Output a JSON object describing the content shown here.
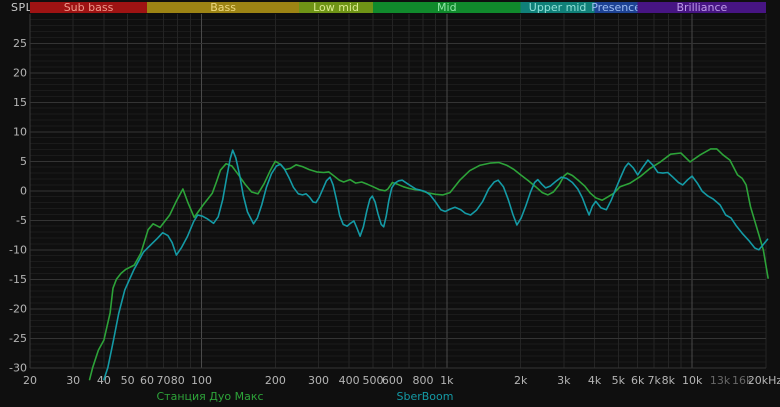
{
  "chart_data": {
    "type": "line",
    "title": "",
    "ylabel": "SPL",
    "xlabel": "",
    "x_scale": "log",
    "xlim": [
      20,
      20000
    ],
    "ylim": [
      -30,
      30
    ],
    "y_tick_step": 5,
    "grid": true,
    "legend_position": "bottom",
    "colors": {
      "background": "#0f0f0f",
      "grid_minor_h": "#1b1b1b",
      "grid_major_h": "#343434",
      "grid_v": "#242424",
      "grid_v_decade": "#4a4a4a",
      "tick_text": "#b5b5b5",
      "tick_text_dim": "#686868",
      "axis_title": "#c9c9c9"
    },
    "bands": [
      {
        "label": "Sub bass",
        "f1": 20,
        "f2": 60,
        "bg": "#9e1313",
        "fg": "#ef9a8c"
      },
      {
        "label": "Bass",
        "f1": 60,
        "f2": 250,
        "bg": "#9d8414",
        "fg": "#ecd87f"
      },
      {
        "label": "Low mid",
        "f1": 250,
        "f2": 500,
        "bg": "#6f9416",
        "fg": "#d9ea8f"
      },
      {
        "label": "Mid",
        "f1": 500,
        "f2": 2000,
        "bg": "#108a2c",
        "fg": "#8fe7a6"
      },
      {
        "label": "Upper mid",
        "f1": 2000,
        "f2": 4000,
        "bg": "#108078",
        "fg": "#8fe0d8"
      },
      {
        "label": "Presence",
        "f1": 4000,
        "f2": 6000,
        "bg": "#1e4394",
        "fg": "#9dbdf2"
      },
      {
        "label": "Brilliance",
        "f1": 6000,
        "f2": 20000,
        "bg": "#471583",
        "fg": "#bd9ae8"
      }
    ],
    "y_ticks": [
      25,
      20,
      15,
      10,
      5,
      0,
      -5,
      -10,
      -15,
      -20,
      -25,
      -30
    ],
    "x_ticks": [
      {
        "label": "20",
        "f": 20,
        "dim": false
      },
      {
        "label": "30",
        "f": 30,
        "dim": false
      },
      {
        "label": "40",
        "f": 40,
        "dim": false
      },
      {
        "label": "50",
        "f": 50,
        "dim": false
      },
      {
        "label": "60",
        "f": 60,
        "dim": false
      },
      {
        "label": "70",
        "f": 70,
        "dim": false
      },
      {
        "label": "80",
        "f": 80,
        "dim": false
      },
      {
        "label": "100",
        "f": 100,
        "dim": false
      },
      {
        "label": "200",
        "f": 200,
        "dim": false
      },
      {
        "label": "300",
        "f": 300,
        "dim": false
      },
      {
        "label": "400",
        "f": 400,
        "dim": false
      },
      {
        "label": "500",
        "f": 500,
        "dim": false
      },
      {
        "label": "600",
        "f": 600,
        "dim": false
      },
      {
        "label": "800",
        "f": 800,
        "dim": false
      },
      {
        "label": "1k",
        "f": 1000,
        "dim": false
      },
      {
        "label": "2k",
        "f": 2000,
        "dim": false
      },
      {
        "label": "3k",
        "f": 3000,
        "dim": false
      },
      {
        "label": "4k",
        "f": 4000,
        "dim": false
      },
      {
        "label": "5k",
        "f": 5000,
        "dim": false
      },
      {
        "label": "6k",
        "f": 6000,
        "dim": false
      },
      {
        "label": "7k",
        "f": 7000,
        "dim": false
      },
      {
        "label": "8k",
        "f": 8000,
        "dim": false
      },
      {
        "label": "10k",
        "f": 10000,
        "dim": false
      },
      {
        "label": "13k",
        "f": 13000,
        "dim": true
      },
      {
        "label": "16k",
        "f": 16000,
        "dim": true
      },
      {
        "label": "20kHz",
        "f": 19800,
        "dim": false
      }
    ],
    "series": [
      {
        "name": "Станция Дуо Макс",
        "color": "#2da339",
        "points": [
          [
            35,
            -32
          ],
          [
            36,
            -30
          ],
          [
            38,
            -27
          ],
          [
            40,
            -25.3
          ],
          [
            42.4,
            -20.7
          ],
          [
            43.6,
            -16.5
          ],
          [
            45,
            -15
          ],
          [
            47,
            -14
          ],
          [
            49.2,
            -13.3
          ],
          [
            53.2,
            -12.6
          ],
          [
            56.6,
            -10.6
          ],
          [
            60.6,
            -6.6
          ],
          [
            63.5,
            -5.6
          ],
          [
            67.8,
            -6.2
          ],
          [
            74.2,
            -4.1
          ],
          [
            79.3,
            -1.6
          ],
          [
            84,
            0.3
          ],
          [
            88,
            -2
          ],
          [
            93.4,
            -4.5
          ],
          [
            101.5,
            -2.4
          ],
          [
            110.7,
            -0.4
          ],
          [
            115,
            1.5
          ],
          [
            119.4,
            3.5
          ],
          [
            126,
            4.6
          ],
          [
            133,
            4.2
          ],
          [
            141,
            2.8
          ],
          [
            150,
            1.2
          ],
          [
            160,
            -0.2
          ],
          [
            170,
            -0.5
          ],
          [
            180,
            1.2
          ],
          [
            190,
            3.3
          ],
          [
            200,
            5
          ],
          [
            210,
            4.5
          ],
          [
            219,
            3.6
          ],
          [
            230,
            3.8
          ],
          [
            243,
            4.4
          ],
          [
            258,
            4.1
          ],
          [
            275,
            3.6
          ],
          [
            295,
            3.2
          ],
          [
            315,
            3.1
          ],
          [
            330,
            3.2
          ],
          [
            345,
            2.6
          ],
          [
            365,
            1.8
          ],
          [
            380,
            1.5
          ],
          [
            403,
            1.9
          ],
          [
            425,
            1.3
          ],
          [
            450,
            1.5
          ],
          [
            475,
            1.1
          ],
          [
            500,
            0.7
          ],
          [
            530,
            0.2
          ],
          [
            560,
            0
          ],
          [
            575,
            0.3
          ],
          [
            600,
            1.4
          ],
          [
            630,
            1.1
          ],
          [
            665,
            0.7
          ],
          [
            700,
            0.4
          ],
          [
            740,
            0.2
          ],
          [
            780,
            0.1
          ],
          [
            830,
            -0.3
          ],
          [
            900,
            -0.6
          ],
          [
            965,
            -0.7
          ],
          [
            1030,
            -0.3
          ],
          [
            1130,
            1.8
          ],
          [
            1240,
            3.4
          ],
          [
            1360,
            4.3
          ],
          [
            1500,
            4.7
          ],
          [
            1630,
            4.8
          ],
          [
            1760,
            4.3
          ],
          [
            1880,
            3.6
          ],
          [
            2000,
            2.7
          ],
          [
            2150,
            1.7
          ],
          [
            2300,
            0.7
          ],
          [
            2450,
            -0.3
          ],
          [
            2580,
            -0.7
          ],
          [
            2720,
            -0.2
          ],
          [
            2870,
            1
          ],
          [
            3000,
            2.5
          ],
          [
            3100,
            3
          ],
          [
            3250,
            2.6
          ],
          [
            3450,
            1.7
          ],
          [
            3650,
            0.8
          ],
          [
            3850,
            -0.4
          ],
          [
            4050,
            -1.2
          ],
          [
            4300,
            -1.6
          ],
          [
            4550,
            -1
          ],
          [
            4800,
            -0.4
          ],
          [
            5085,
            0.7
          ],
          [
            5590,
            1.3
          ],
          [
            6140,
            2.4
          ],
          [
            6740,
            3.8
          ],
          [
            7420,
            4.9
          ],
          [
            8170,
            6.2
          ],
          [
            9000,
            6.4
          ],
          [
            9810,
            4.9
          ],
          [
            10800,
            6.1
          ],
          [
            11900,
            7.1
          ],
          [
            12600,
            7.1
          ],
          [
            13350,
            6.1
          ],
          [
            14250,
            5.2
          ],
          [
            15300,
            2.7
          ],
          [
            16000,
            2.1
          ],
          [
            16600,
            1
          ],
          [
            17300,
            -2.7
          ],
          [
            18300,
            -6.1
          ],
          [
            19500,
            -10
          ],
          [
            20400,
            -14.8
          ]
        ]
      },
      {
        "name": "SberBoom",
        "color": "#149aa5",
        "points": [
          [
            40,
            -32
          ],
          [
            41.5,
            -30
          ],
          [
            43.8,
            -25.3
          ],
          [
            46,
            -20.8
          ],
          [
            48.7,
            -16.8
          ],
          [
            53,
            -13.4
          ],
          [
            58,
            -10.4
          ],
          [
            63,
            -8.9
          ],
          [
            66,
            -8.1
          ],
          [
            69.5,
            -7.1
          ],
          [
            73,
            -7.6
          ],
          [
            76,
            -8.8
          ],
          [
            79,
            -10.9
          ],
          [
            83,
            -9.6
          ],
          [
            87.5,
            -7.8
          ],
          [
            93,
            -5.2
          ],
          [
            96.5,
            -4.1
          ],
          [
            101,
            -4.3
          ],
          [
            106,
            -4.8
          ],
          [
            112,
            -5.5
          ],
          [
            117,
            -4.4
          ],
          [
            122,
            -1.5
          ],
          [
            127,
            2.5
          ],
          [
            131,
            5.5
          ],
          [
            134,
            6.9
          ],
          [
            138,
            5.6
          ],
          [
            143,
            2.7
          ],
          [
            148,
            -0.8
          ],
          [
            154,
            -3.6
          ],
          [
            163,
            -5.6
          ],
          [
            169,
            -4.6
          ],
          [
            176,
            -2.4
          ],
          [
            184,
            0.6
          ],
          [
            193,
            2.9
          ],
          [
            202,
            4.2
          ],
          [
            210,
            4.5
          ],
          [
            218,
            3.7
          ],
          [
            227,
            2.3
          ],
          [
            237,
            0.6
          ],
          [
            248,
            -0.5
          ],
          [
            258,
            -0.7
          ],
          [
            267,
            -0.5
          ],
          [
            276,
            -1.1
          ],
          [
            285,
            -1.9
          ],
          [
            293,
            -2
          ],
          [
            302,
            -1.1
          ],
          [
            313,
            0.4
          ],
          [
            323,
            1.7
          ],
          [
            334,
            2.3
          ],
          [
            344,
            1
          ],
          [
            355,
            -1.5
          ],
          [
            366,
            -4.2
          ],
          [
            378,
            -5.7
          ],
          [
            392,
            -6
          ],
          [
            405,
            -5.5
          ],
          [
            418,
            -5.1
          ],
          [
            430,
            -6.3
          ],
          [
            443,
            -7.7
          ],
          [
            457,
            -6.1
          ],
          [
            472,
            -3.4
          ],
          [
            486,
            -1.4
          ],
          [
            497,
            -0.9
          ],
          [
            510,
            -1.9
          ],
          [
            524,
            -3.9
          ],
          [
            540,
            -5.7
          ],
          [
            553,
            -6.1
          ],
          [
            566,
            -4.3
          ],
          [
            580,
            -1.7
          ],
          [
            596,
            0.5
          ],
          [
            615,
            1.3
          ],
          [
            636,
            1.7
          ],
          [
            658,
            1.8
          ],
          [
            685,
            1.3
          ],
          [
            715,
            0.8
          ],
          [
            748,
            0.3
          ],
          [
            780,
            0.1
          ],
          [
            815,
            -0.1
          ],
          [
            855,
            -0.7
          ],
          [
            900,
            -1.9
          ],
          [
            945,
            -3.2
          ],
          [
            985,
            -3.5
          ],
          [
            1030,
            -3.1
          ],
          [
            1080,
            -2.8
          ],
          [
            1140,
            -3.2
          ],
          [
            1190,
            -3.8
          ],
          [
            1250,
            -4.1
          ],
          [
            1320,
            -3.3
          ],
          [
            1400,
            -1.8
          ],
          [
            1480,
            0.3
          ],
          [
            1560,
            1.5
          ],
          [
            1620,
            1.8
          ],
          [
            1700,
            0.7
          ],
          [
            1780,
            -1.5
          ],
          [
            1860,
            -4
          ],
          [
            1930,
            -5.8
          ],
          [
            2010,
            -4.6
          ],
          [
            2100,
            -2.5
          ],
          [
            2190,
            -0.3
          ],
          [
            2280,
            1.4
          ],
          [
            2350,
            1.9
          ],
          [
            2440,
            1.1
          ],
          [
            2530,
            0.5
          ],
          [
            2640,
            0.8
          ],
          [
            2780,
            1.6
          ],
          [
            2930,
            2.3
          ],
          [
            3080,
            2.1
          ],
          [
            3250,
            1.4
          ],
          [
            3420,
            0.3
          ],
          [
            3570,
            -1.2
          ],
          [
            3700,
            -2.9
          ],
          [
            3800,
            -4.1
          ],
          [
            3920,
            -2.6
          ],
          [
            4050,
            -1.8
          ],
          [
            4250,
            -2.9
          ],
          [
            4470,
            -3.2
          ],
          [
            4680,
            -1.6
          ],
          [
            4880,
            0.3
          ],
          [
            5100,
            2.2
          ],
          [
            5330,
            4
          ],
          [
            5500,
            4.7
          ],
          [
            5750,
            3.9
          ],
          [
            6000,
            2.7
          ],
          [
            6270,
            3.9
          ],
          [
            6600,
            5.2
          ],
          [
            6900,
            4.4
          ],
          [
            7250,
            3.1
          ],
          [
            7600,
            3
          ],
          [
            7950,
            3.1
          ],
          [
            8300,
            2.4
          ],
          [
            8800,
            1.4
          ],
          [
            9150,
            1
          ],
          [
            9600,
            1.9
          ],
          [
            10000,
            2.5
          ],
          [
            10500,
            1.3
          ],
          [
            11000,
            -0.1
          ],
          [
            11600,
            -0.9
          ],
          [
            12200,
            -1.4
          ],
          [
            13000,
            -2.4
          ],
          [
            13700,
            -4.1
          ],
          [
            14400,
            -4.6
          ],
          [
            15100,
            -5.9
          ],
          [
            16000,
            -7.2
          ],
          [
            17000,
            -8.4
          ],
          [
            18000,
            -9.7
          ],
          [
            18700,
            -10
          ],
          [
            19400,
            -9.2
          ],
          [
            20300,
            -8.2
          ]
        ]
      }
    ]
  }
}
